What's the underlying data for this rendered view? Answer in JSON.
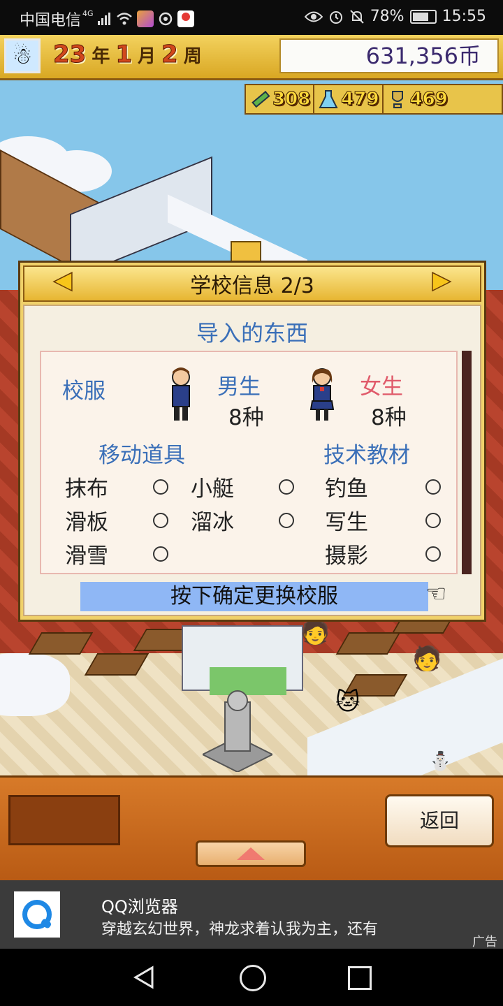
{
  "status_bar": {
    "carrier": "中国电信",
    "network": "4G",
    "battery": "78%",
    "time": "15:55"
  },
  "header": {
    "year": "23",
    "year_unit": "年",
    "month": "1",
    "month_unit": "月",
    "week": "2",
    "week_unit": "周",
    "money": "631,356币"
  },
  "stats": [
    {
      "icon": "pencil-icon",
      "value": "308"
    },
    {
      "icon": "flask-icon",
      "value": "479"
    },
    {
      "icon": "trophy-icon",
      "value": "469"
    }
  ],
  "dialog": {
    "title": "学校信息 2/3",
    "section_title": "导入的东西",
    "uniform_label": "校服",
    "boys_label": "男生",
    "boys_count": "8种",
    "girls_label": "女生",
    "girls_count": "8种",
    "mobility_header": "移动道具",
    "tech_header": "技术教材",
    "items": {
      "rag": "抹布",
      "boat": "小艇",
      "fishing": "钓鱼",
      "skateboard": "滑板",
      "skate": "溜冰",
      "sketch": "写生",
      "ski": "滑雪",
      "photo": "摄影"
    },
    "confirm_text": "按下确定更换校服"
  },
  "bottom": {
    "back_label": "返回"
  },
  "ad": {
    "title": "QQ浏览器",
    "description": "穿越玄幻世界，神龙求着认我为主，还有",
    "tag": "广告"
  },
  "colors": {
    "header_gold": "#e8c44a",
    "dialog_blue_text": "#3a6fb8",
    "girls_pink": "#e05a6a",
    "confirm_bg": "#8fb7f5"
  }
}
